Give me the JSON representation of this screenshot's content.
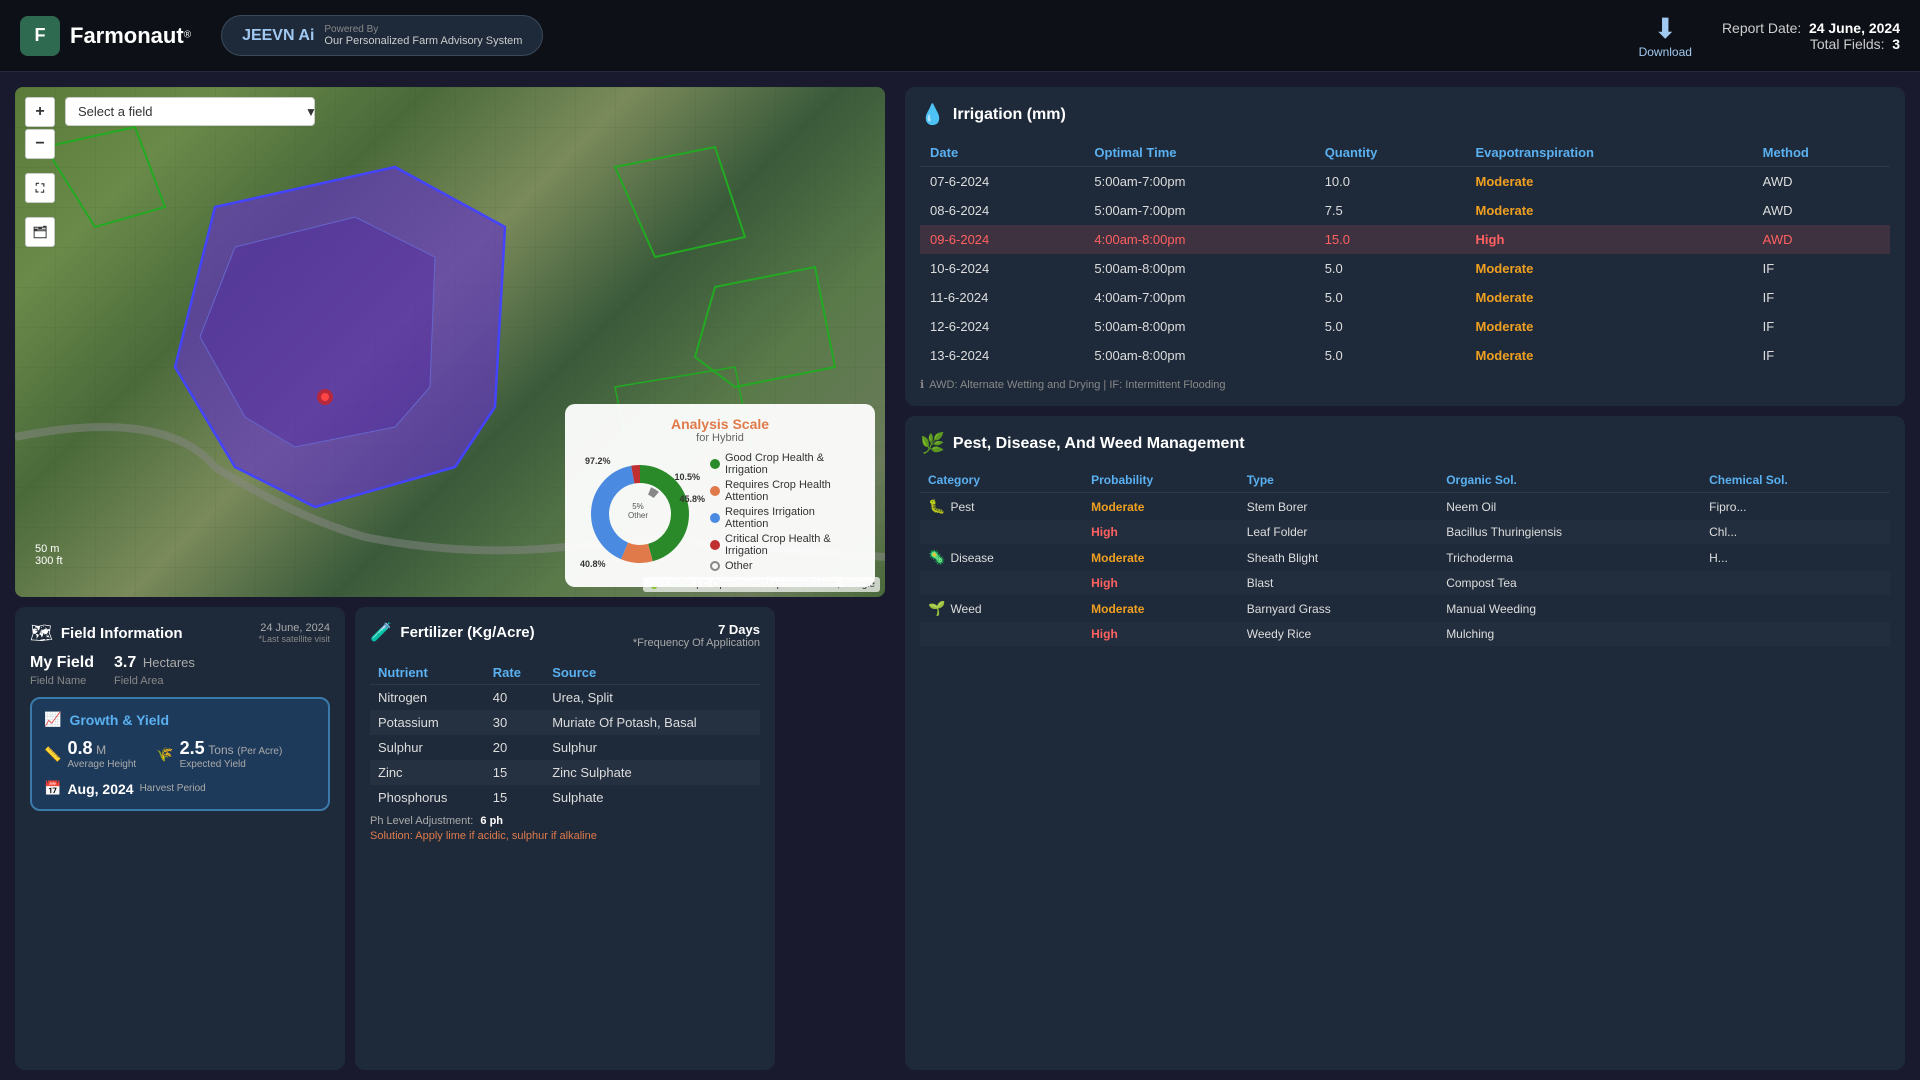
{
  "header": {
    "logo_text": "Farmonaut",
    "logo_reg": "®",
    "jeevn_brand": "JEEVN Ai",
    "powered_by": "Powered By",
    "jeevn_tagline": "Our Personalized Farm Advisory System",
    "download_label": "Download",
    "report_date_label": "Report Date:",
    "report_date": "24 June, 2024",
    "total_fields_label": "Total Fields:",
    "total_fields": "3"
  },
  "map": {
    "field_select_placeholder": "Select a field",
    "zoom_in": "+",
    "zoom_out": "−",
    "scale_m": "50 m",
    "scale_ft": "300 ft",
    "attribution": "Leaflet | © OpenStreetMap contributors, Google",
    "analysis_scale": {
      "title": "Analysis Scale",
      "subtitle": "for Hybrid",
      "pct_972": "97.2%",
      "pct_105": "10.5%",
      "pct_458": "45.8%",
      "pct_408": "40.8%",
      "pct_5": "5%",
      "pct_5_label": "Other",
      "legend": [
        {
          "color": "#2a8a2a",
          "label": "Good Crop Health & Irrigation"
        },
        {
          "color": "#e07a4a",
          "label": "Requires Crop Health Attention"
        },
        {
          "color": "#4a8ae0",
          "label": "Requires Irrigation Attention"
        },
        {
          "color": "#c03030",
          "label": "Critical Crop Health & Irrigation"
        },
        {
          "color": null,
          "label": "Other"
        }
      ]
    }
  },
  "field_info": {
    "section_title": "Field Information",
    "date": "24 June, 2024",
    "satellite_note": "*Last satellite visit",
    "field_name_label": "Field Name",
    "field_name": "My Field",
    "field_area_label": "Field Area",
    "field_area_value": "3.7",
    "field_area_unit": "Hectares",
    "growth_title": "Growth & Yield",
    "height_value": "0.8",
    "height_unit": "M",
    "height_label": "Average Height",
    "yield_value": "2.5",
    "yield_unit": "Tons",
    "yield_per": "(Per Acre)",
    "yield_label": "Expected Yield",
    "harvest_date": "Aug, 2024",
    "harvest_label": "Harvest Period"
  },
  "fertilizer": {
    "section_title": "Fertilizer (Kg/Acre)",
    "freq_days": "7 Days",
    "freq_label": "*Frequency Of Application",
    "col_nutrient": "Nutrient",
    "col_rate": "Rate",
    "col_source": "Source",
    "rows": [
      {
        "nutrient": "Nitrogen",
        "rate": "40",
        "source": "Urea, Split"
      },
      {
        "nutrient": "Potassium",
        "rate": "30",
        "source": "Muriate Of Potash, Basal"
      },
      {
        "nutrient": "Sulphur",
        "rate": "20",
        "source": "Sulphur"
      },
      {
        "nutrient": "Zinc",
        "rate": "15",
        "source": "Zinc Sulphate"
      },
      {
        "nutrient": "Phosphorus",
        "rate": "15",
        "source": "Sulphate"
      }
    ],
    "ph_label": "Ph Level Adjustment:",
    "ph_value": "6 ph",
    "solution": "Solution: Apply lime if acidic, sulphur if alkaline"
  },
  "irrigation": {
    "section_title": "Irrigation (mm)",
    "col_date": "Date",
    "col_optimal": "Optimal Time",
    "col_quantity": "Quantity",
    "col_evap": "Evapotranspiration",
    "col_method": "Method",
    "rows": [
      {
        "date": "07-6-2024",
        "optimal": "5:00am-7:00pm",
        "quantity": "10.0",
        "evap": "Moderate",
        "method": "AWD",
        "highlight": false
      },
      {
        "date": "08-6-2024",
        "optimal": "5:00am-7:00pm",
        "quantity": "7.5",
        "evap": "Moderate",
        "method": "AWD",
        "highlight": false
      },
      {
        "date": "09-6-2024",
        "optimal": "4:00am-8:00pm",
        "quantity": "15.0",
        "evap": "High",
        "method": "AWD",
        "highlight": true
      },
      {
        "date": "10-6-2024",
        "optimal": "5:00am-8:00pm",
        "quantity": "5.0",
        "evap": "Moderate",
        "method": "IF",
        "highlight": false
      },
      {
        "date": "11-6-2024",
        "optimal": "4:00am-7:00pm",
        "quantity": "5.0",
        "evap": "Moderate",
        "method": "IF",
        "highlight": false
      },
      {
        "date": "12-6-2024",
        "optimal": "5:00am-8:00pm",
        "quantity": "5.0",
        "evap": "Moderate",
        "method": "IF",
        "highlight": false
      },
      {
        "date": "13-6-2024",
        "optimal": "5:00am-8:00pm",
        "quantity": "5.0",
        "evap": "Moderate",
        "method": "IF",
        "highlight": false
      }
    ],
    "footnote": "AWD: Alternate Wetting and Drying | IF: Intermittent Flooding"
  },
  "pest": {
    "section_title": "Pest, Disease, And Weed Management",
    "col_category": "Category",
    "col_probability": "Probability",
    "col_type": "Type",
    "col_organic": "Organic Sol.",
    "col_chemical": "Chemical Sol.",
    "rows": [
      {
        "category": "Pest",
        "cat_icon": "🐛",
        "probability": "Moderate",
        "prob_color": "moderate",
        "type": "Stem Borer",
        "organic": "Neem Oil",
        "chemical": "Fipro..."
      },
      {
        "category": "Pest",
        "cat_icon": "🐛",
        "probability": "High",
        "prob_color": "high",
        "type": "Leaf Folder",
        "organic": "Bacillus Thuringiensis",
        "chemical": "Chl..."
      },
      {
        "category": "Disease",
        "cat_icon": "🌿",
        "probability": "Moderate",
        "prob_color": "moderate",
        "type": "Sheath Blight",
        "organic": "Trichoderma",
        "chemical": "H..."
      },
      {
        "category": "Disease",
        "cat_icon": "🌿",
        "probability": "High",
        "prob_color": "high",
        "type": "Blast",
        "organic": "Compost Tea",
        "chemical": ""
      },
      {
        "category": "Weed",
        "cat_icon": "🌱",
        "probability": "Moderate",
        "prob_color": "moderate",
        "type": "Barnyard Grass",
        "organic": "Manual Weeding",
        "chemical": ""
      },
      {
        "category": "Weed",
        "cat_icon": "🌱",
        "probability": "High",
        "prob_color": "high",
        "type": "Weedy Rice",
        "organic": "Mulching",
        "chemical": ""
      }
    ]
  },
  "colors": {
    "accent_blue": "#5ab0f0",
    "accent_orange": "#e07a4a",
    "high_red": "#ff6060",
    "moderate_orange": "#f0a020",
    "good_green": "#2a8a2a",
    "bg_dark": "#0d1117",
    "card_bg": "#1e2a3a"
  }
}
